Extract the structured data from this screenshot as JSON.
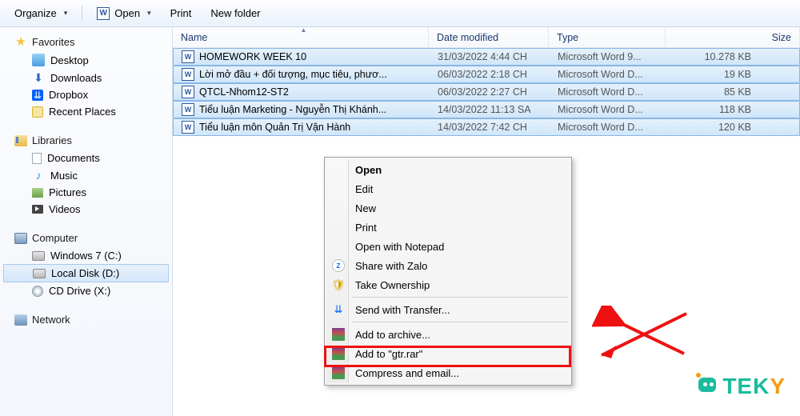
{
  "toolbar": {
    "organize": "Organize",
    "open": "Open",
    "print": "Print",
    "new_folder": "New folder"
  },
  "sidebar": {
    "favorites": {
      "label": "Favorites",
      "items": [
        {
          "label": "Desktop"
        },
        {
          "label": "Downloads"
        },
        {
          "label": "Dropbox"
        },
        {
          "label": "Recent Places"
        }
      ]
    },
    "libraries": {
      "label": "Libraries",
      "items": [
        {
          "label": "Documents"
        },
        {
          "label": "Music"
        },
        {
          "label": "Pictures"
        },
        {
          "label": "Videos"
        }
      ]
    },
    "computer": {
      "label": "Computer",
      "items": [
        {
          "label": "Windows 7 (C:)"
        },
        {
          "label": "Local Disk (D:)"
        },
        {
          "label": "CD Drive (X:)"
        }
      ]
    },
    "network": {
      "label": "Network"
    }
  },
  "columns": {
    "name": "Name",
    "date": "Date modified",
    "type": "Type",
    "size": "Size"
  },
  "files": [
    {
      "name": "HOMEWORK WEEK 10",
      "date": "31/03/2022 4:44 CH",
      "type": "Microsoft Word 9...",
      "size": "10.278 KB"
    },
    {
      "name": "Lời mở đầu + đối tượng, mục tiêu, phươ...",
      "date": "06/03/2022 2:18 CH",
      "type": "Microsoft Word D...",
      "size": "19 KB"
    },
    {
      "name": "QTCL-Nhom12-ST2",
      "date": "06/03/2022 2:27 CH",
      "type": "Microsoft Word D...",
      "size": "85 KB"
    },
    {
      "name": "Tiểu luận Marketing - Nguyễn Thị Khánh...",
      "date": "14/03/2022 11:13 SA",
      "type": "Microsoft Word D...",
      "size": "118 KB"
    },
    {
      "name": "Tiểu luận môn Quản Trị Vận Hành",
      "date": "14/03/2022 7:42 CH",
      "type": "Microsoft Word D...",
      "size": "120 KB"
    }
  ],
  "context_menu": {
    "open": "Open",
    "edit": "Edit",
    "new": "New",
    "print": "Print",
    "open_notepad": "Open with Notepad",
    "share_zalo": "Share with Zalo",
    "take_ownership": "Take Ownership",
    "send_transfer": "Send with Transfer...",
    "add_archive": "Add to archive...",
    "add_gtr": "Add to \"gtr.rar\"",
    "compress_email": "Compress and email..."
  },
  "logo": {
    "text": "TEKY"
  }
}
